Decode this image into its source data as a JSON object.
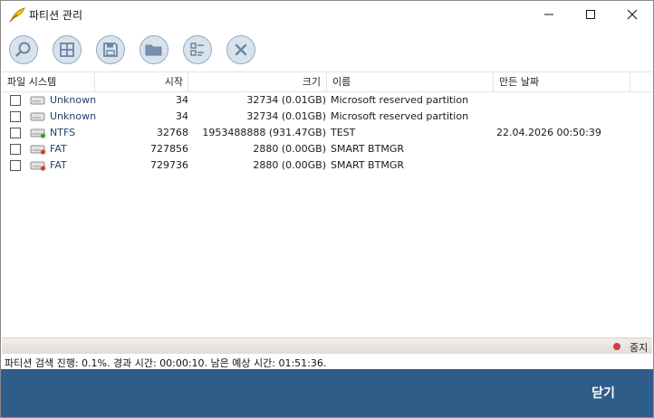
{
  "window": {
    "title": "파티션 관리"
  },
  "toolbar": {
    "buttons": [
      "search-icon",
      "grid-icon",
      "save-icon",
      "folder-icon",
      "partition-map-icon",
      "close-icon"
    ]
  },
  "table": {
    "columns": {
      "fs": "파일 시스템",
      "start": "시작",
      "size": "크기",
      "name": "이름",
      "date": "만든 날짜"
    },
    "rows": [
      {
        "fs": "Unknown",
        "start": "34",
        "size": "32734 (0.01GB)",
        "name": "Microsoft reserved partition",
        "date": "",
        "status": "none"
      },
      {
        "fs": "Unknown",
        "start": "34",
        "size": "32734 (0.01GB)",
        "name": "Microsoft reserved partition",
        "date": "",
        "status": "none"
      },
      {
        "fs": "NTFS",
        "start": "32768",
        "size": "1953488888 (931.47GB)",
        "name": "TEST",
        "date": "22.04.2026 00:50:39",
        "status": "green"
      },
      {
        "fs": "FAT",
        "start": "727856",
        "size": "2880 (0.00GB)",
        "name": "SMART BTMGR",
        "date": "",
        "status": "red"
      },
      {
        "fs": "FAT",
        "start": "729736",
        "size": "2880 (0.00GB)",
        "name": "SMART BTMGR",
        "date": "",
        "status": "red"
      }
    ]
  },
  "status": {
    "stop_label": "중지",
    "progress_text": "파티션 검색 진행: 0.1%. 경과 시간: 00:00:10. 남은 예상 시간: 01:51:36.",
    "progress_percent": 0.1
  },
  "footer": {
    "close_label": "닫기"
  },
  "colors": {
    "footer_bg": "#2f5d8a",
    "fs_text": "#20446e",
    "stop_dot": "#d23b3b",
    "status_green": "#2fa33a",
    "status_red": "#d23b3b"
  }
}
